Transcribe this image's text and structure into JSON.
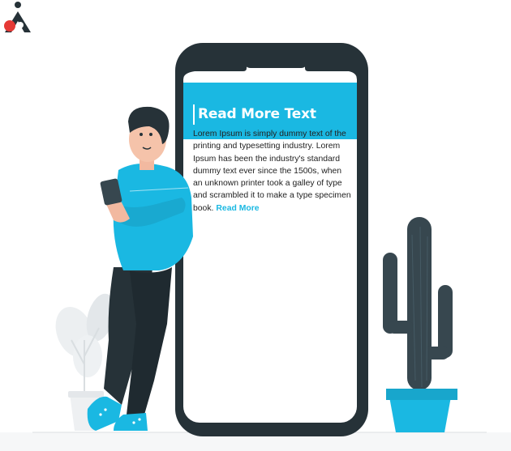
{
  "app": {
    "header_title": "Read More Text",
    "body_text": "Lorem Ipsum is simply dummy text of the printing and typesetting industry. Lorem Ipsum has been the industry's standard dummy text ever since the 1500s, when an unknown printer took a galley of type and scrambled it to make a type specimen book.",
    "read_more_label": "Read More"
  },
  "colors": {
    "accent": "#1ab8e2",
    "phone_frame": "#263238",
    "screen": "#ffffff",
    "cactus": "#37474f",
    "pot": "#1ab8e2",
    "logo_red": "#e53935"
  },
  "icons": [
    "brand-logo-icon",
    "cactus-illustration",
    "person-illustration",
    "plant-illustration",
    "smartphone-illustration"
  ]
}
